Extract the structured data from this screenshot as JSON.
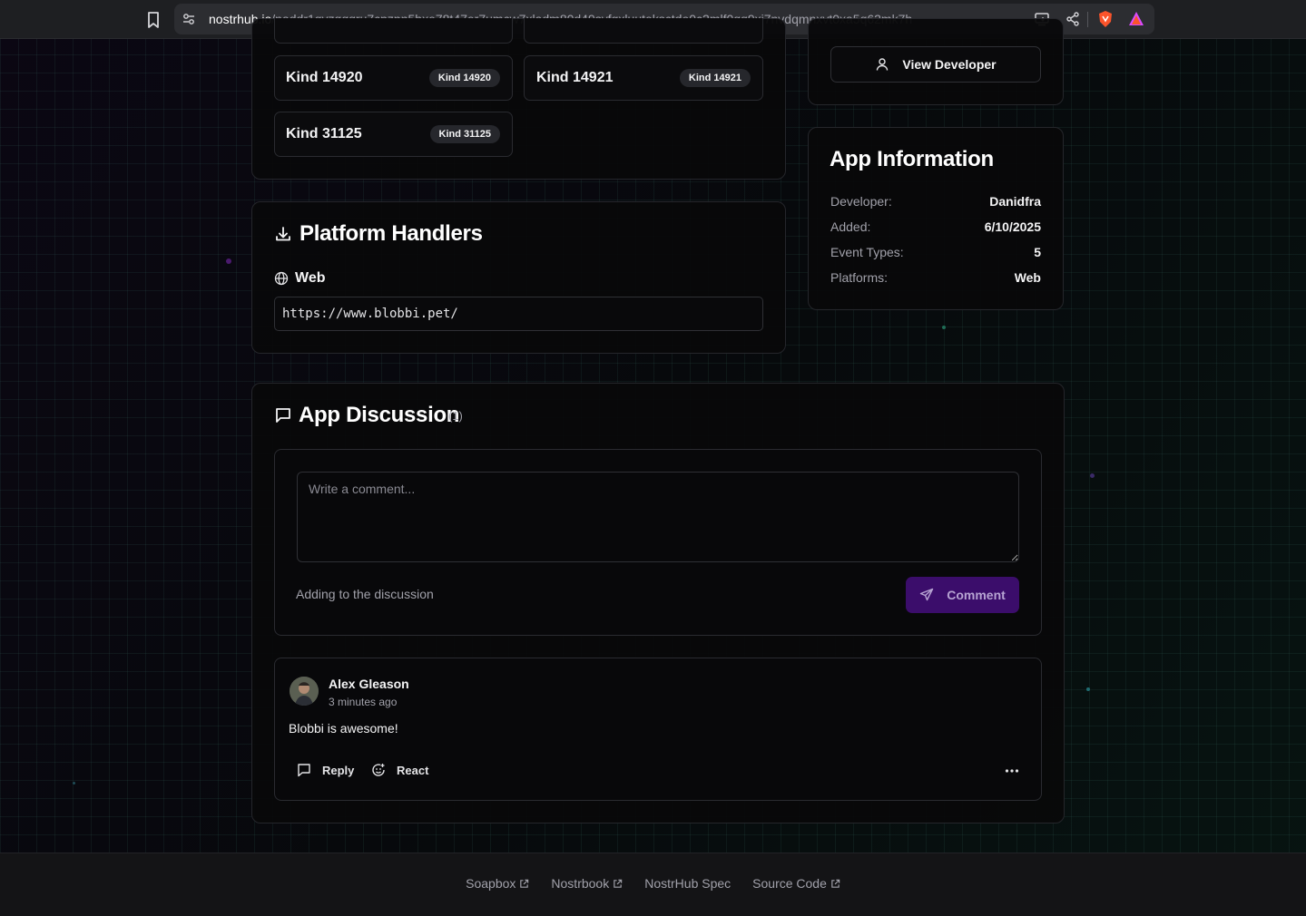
{
  "browser": {
    "url_domain": "nostrhub.io",
    "url_path": "/naddr1qvzqqqru7cpzpn5hxe78t47er7umcw7xladm80d49svfgxluuteksctde0c2mlf0qq9xj7nvdqmnxvt0xa5q62mk7h"
  },
  "kinds": {
    "items": [
      {
        "title": "Kind 14920",
        "badge": "Kind 14920"
      },
      {
        "title": "Kind 14921",
        "badge": "Kind 14921"
      },
      {
        "title": "Kind 31125",
        "badge": "Kind 31125"
      }
    ]
  },
  "developer_card": {
    "view_developer_label": "View Developer"
  },
  "app_info": {
    "title": "App Information",
    "rows": [
      {
        "label": "Developer:",
        "value": "Danidfra"
      },
      {
        "label": "Added:",
        "value": "6/10/2025"
      },
      {
        "label": "Event Types:",
        "value": "5"
      },
      {
        "label": "Platforms:",
        "value": "Web"
      }
    ]
  },
  "platform_handlers": {
    "title": "Platform Handlers",
    "platform_name": "Web",
    "url": "https://www.blobbi.pet/"
  },
  "discussion": {
    "title": "App Discussion",
    "count": "(1)",
    "comment_placeholder": "Write a comment...",
    "helper_text": "Adding to the discussion",
    "comment_button_label": "Comment",
    "comments": [
      {
        "author": "Alex Gleason",
        "time": "3 minutes ago",
        "text": "Blobbi is awesome!",
        "reply_label": "Reply",
        "react_label": "React"
      }
    ]
  },
  "footer": {
    "links": [
      {
        "label": "Soapbox",
        "external": true
      },
      {
        "label": "Nostrbook",
        "external": true
      },
      {
        "label": "NostrHub Spec",
        "external": false
      },
      {
        "label": "Source Code",
        "external": true
      }
    ]
  },
  "colors": {
    "accent_purple": "#3b0d6b",
    "background": "#07080b",
    "card": "#08080a"
  }
}
